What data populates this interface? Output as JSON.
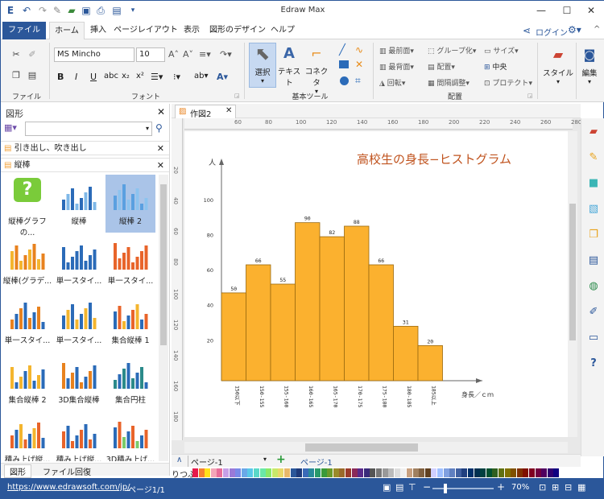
{
  "window": {
    "title": "Edraw Max"
  },
  "quick_access": [
    "app-icon",
    "undo-icon",
    "redo-icon",
    "paint-icon",
    "save-icon",
    "print-icon",
    "export-icon",
    "more-icon"
  ],
  "window_buttons": {
    "minimize": "—",
    "maximize": "☐",
    "close": "✕"
  },
  "tabs": [
    {
      "label": "ファイル",
      "file": true
    },
    {
      "label": "ホーム",
      "active": true
    },
    {
      "label": "挿入"
    },
    {
      "label": "ページレイアウト"
    },
    {
      "label": "表示"
    },
    {
      "label": "図形のデザイン"
    },
    {
      "label": "ヘルプ"
    }
  ],
  "account": {
    "login": "ログイン"
  },
  "ribbon": {
    "file_group": "ファイル",
    "font_group": "フォント",
    "tools_group": "基本ツール",
    "arrange_group": "配置",
    "font_name": "MS Mincho",
    "font_size": "10",
    "select_label": "選択",
    "text_label": "テキスト",
    "connector_label": "コネクタ",
    "bring_front": "最前面",
    "send_back": "最背面",
    "rotate": "回転",
    "group": "グループ化",
    "align": "配置",
    "spacing": "間隔調整",
    "size": "サイズ",
    "center": "中央",
    "protect": "プロテクト",
    "style": "スタイル",
    "edit": "編集"
  },
  "left_panel": {
    "title": "図形",
    "search_placeholder": "",
    "lib1": "引き出し、吹き出し",
    "lib2": "縦棒",
    "shapes": [
      "縦棒グラフの...",
      "縦棒",
      "縦棒 2",
      "縦棒(グラデ...",
      "単一スタイ...",
      "単一スタイ...",
      "単一スタイ...",
      "単一スタイ...",
      "集合縦棒 1",
      "集合縦棒 2",
      "3D集合縦棒",
      "集合円柱",
      "積み上げ縦...",
      "積み上げ縦...",
      "3D積み上げ..."
    ],
    "bottom_tabs": [
      "図形",
      "ファイル回復"
    ]
  },
  "doc_tab": "作図2",
  "ruler_marks": [
    "60",
    "80",
    "100",
    "120",
    "140",
    "160",
    "180",
    "200",
    "220",
    "240",
    "260",
    "280"
  ],
  "chart_data": {
    "type": "bar",
    "title": "高校生の身長−ヒストグラム",
    "ylabel": "人",
    "xlabel": "身長／ｃｍ",
    "ylim": [
      0,
      110
    ],
    "yticks": [
      20,
      40,
      60,
      80,
      100
    ],
    "categories": [
      "150以下",
      "150-155",
      "155-160",
      "160-165",
      "165-170",
      "170-175",
      "175-180",
      "180-185",
      "185以上"
    ],
    "values": [
      50,
      66,
      55,
      90,
      82,
      88,
      66,
      31,
      20
    ],
    "bar_color": "#fbb12f"
  },
  "page_bar": {
    "page_select": "ページ-1",
    "page_tab": "ページ-1"
  },
  "color_bar_label": "りつぶ",
  "status": {
    "url": "https://www.edrawsoft.com/jp/",
    "page": "ページ1/1",
    "zoom": "70%"
  }
}
